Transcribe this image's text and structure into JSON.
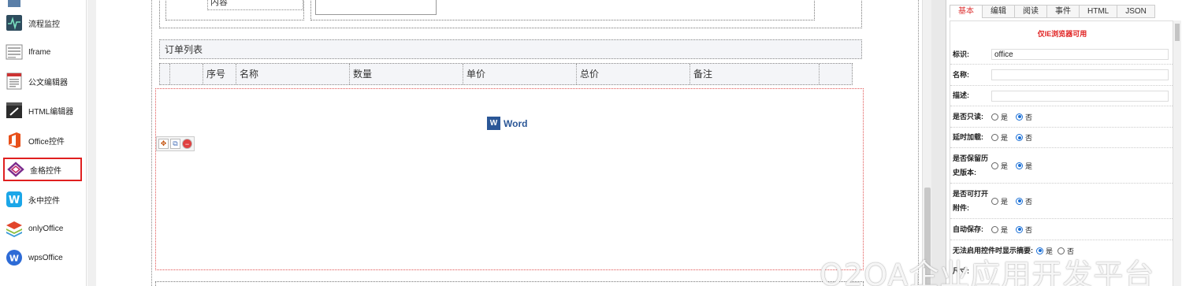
{
  "palette": {
    "items": [
      {
        "label": "",
        "icon": "component-icon"
      },
      {
        "label": "流程监控",
        "icon": "process-monitor-icon"
      },
      {
        "label": "Iframe",
        "icon": "iframe-icon"
      },
      {
        "label": "公文编辑器",
        "icon": "document-editor-icon"
      },
      {
        "label": "HTML编辑器",
        "icon": "html-editor-icon"
      },
      {
        "label": "Office控件",
        "icon": "office-icon"
      },
      {
        "label": "金格控件",
        "icon": "kinggrid-icon"
      },
      {
        "label": "永中控件",
        "icon": "yozo-icon"
      },
      {
        "label": "onlyOffice",
        "icon": "onlyoffice-icon"
      },
      {
        "label": "wpsOffice",
        "icon": "wps-icon"
      }
    ],
    "selected_index": 6
  },
  "canvas": {
    "content_field_value": "内容",
    "order_list_title": "订单列表",
    "table_headers": [
      "序号",
      "名称",
      "数量",
      "单价",
      "总价",
      "备注"
    ],
    "word_label": "Word",
    "word_icon_letter": "W"
  },
  "panel": {
    "tabs": [
      "基本",
      "编辑",
      "阅读",
      "事件",
      "HTML",
      "JSON"
    ],
    "active_tab": 0,
    "ie_note": "仅IE浏览器可用",
    "fields": {
      "id_label": "标识:",
      "id_value": "office",
      "name_label": "名称:",
      "name_value": "",
      "desc_label": "描述:",
      "desc_value": ""
    },
    "options": [
      {
        "label": "是否只读:",
        "yes": "是",
        "no": "否",
        "selected": "no"
      },
      {
        "label": "延时加载:",
        "yes": "是",
        "no": "否",
        "selected": "no"
      },
      {
        "label": "是否保留历史版本:",
        "yes": "是",
        "no": "是",
        "selected": "no"
      },
      {
        "label": "是否可打开附件:",
        "yes": "是",
        "no": "否",
        "selected": "no"
      },
      {
        "label": "自动保存:",
        "yes": "是",
        "no": "否",
        "selected": "no"
      },
      {
        "label": "无法启用控件时显示摘要:",
        "yes": "是",
        "no": "否",
        "selected": "yes"
      }
    ],
    "last_label": "尺寸:"
  },
  "watermark": "O2OA企业应用开发平台",
  "colors": {
    "accent_red": "#e02020",
    "radio_blue": "#1a6fd6",
    "word_blue": "#2b5797"
  }
}
